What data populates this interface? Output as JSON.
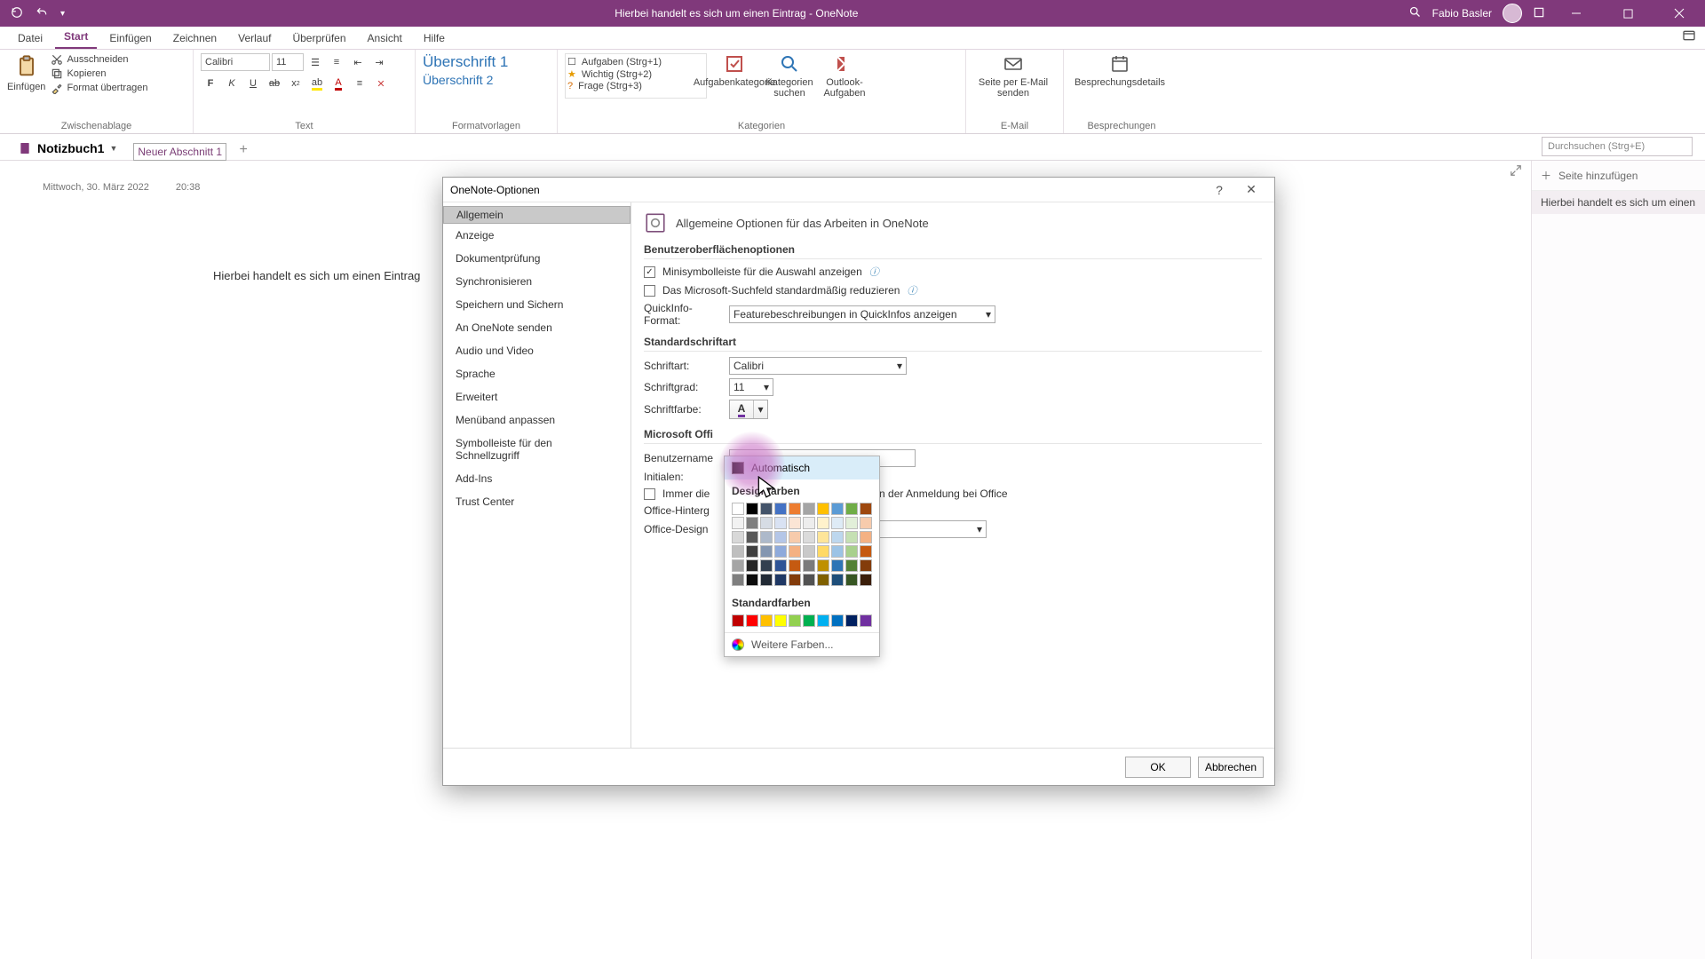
{
  "titlebar": {
    "title": "Hierbei handelt es sich um einen Eintrag  -  OneNote",
    "user": "Fabio Basler"
  },
  "menu": {
    "tabs": [
      "Datei",
      "Start",
      "Einfügen",
      "Zeichnen",
      "Verlauf",
      "Überprüfen",
      "Ansicht",
      "Hilfe"
    ],
    "active_index": 1
  },
  "ribbon": {
    "clipboard": {
      "paste": "Einfügen",
      "cut": "Ausschneiden",
      "copy": "Kopieren",
      "format": "Format übertragen",
      "group": "Zwischenablage"
    },
    "font": {
      "name": "Calibri",
      "size": "11",
      "group": "Text"
    },
    "styles": {
      "h1": "Überschrift 1",
      "h2": "Überschrift 2",
      "group": "Formatvorlagen"
    },
    "tags": {
      "items": [
        "Aufgaben (Strg+1)",
        "Wichtig (Strg+2)",
        "Frage (Strg+3)"
      ],
      "btn1": "Aufgabenkategorie",
      "btn2": "Kategorien suchen",
      "btn3": "Outlook-Aufgaben",
      "group": "Kategorien"
    },
    "email": {
      "btn": "Seite per E-Mail senden",
      "group": "E-Mail"
    },
    "meet": {
      "btn": "Besprechungsdetails",
      "group": "Besprechungen"
    }
  },
  "notebook": {
    "name": "Notizbuch1",
    "section": "Neuer Abschnitt 1",
    "search_placeholder": "Durchsuchen (Strg+E)"
  },
  "page": {
    "date": "Mittwoch, 30. März 2022",
    "time": "20:38",
    "text": "Hierbei handelt es sich um einen Eintrag"
  },
  "pagelist": {
    "add": "Seite hinzufügen",
    "item": "Hierbei handelt es sich um einen"
  },
  "dialog": {
    "title": "OneNote-Optionen",
    "nav": [
      "Allgemein",
      "Anzeige",
      "Dokumentprüfung",
      "Synchronisieren",
      "Speichern und Sichern",
      "An OneNote senden",
      "Audio und Video",
      "Sprache",
      "Erweitert",
      "Menüband anpassen",
      "Symbolleiste für den Schnellzugriff",
      "Add-Ins",
      "Trust Center"
    ],
    "nav_selected": 0,
    "heading": "Allgemeine Optionen für das Arbeiten in OneNote",
    "sec1": "Benutzeroberflächenoptionen",
    "chk_mini": "Minisymbolleiste für die Auswahl anzeigen",
    "chk_search": "Das Microsoft-Suchfeld standardmäßig reduzieren",
    "quickinfo_label": "QuickInfo-Format:",
    "quickinfo_value": "Featurebeschreibungen in QuickInfos anzeigen",
    "sec2": "Standardschriftart",
    "font_label": "Schriftart:",
    "font_value": "Calibri",
    "size_label": "Schriftgrad:",
    "size_value": "11",
    "color_label": "Schriftfarbe:",
    "sec3": "Microsoft Offi",
    "user_label": "Benutzername",
    "initials_label": "Initialen:",
    "always_label": "Immer die",
    "always_tail": "g von der Anmeldung bei Office",
    "bg_label": "Office-Hinterg",
    "theme_label": "Office-Design",
    "ok": "OK",
    "cancel": "Abbrechen"
  },
  "picker": {
    "auto": "Automatisch",
    "theme": "Designfarben",
    "theme_row": [
      "#ffffff",
      "#000000",
      "#44546a",
      "#4472c4",
      "#ed7d31",
      "#a5a5a5",
      "#ffc000",
      "#5b9bd5",
      "#70ad47",
      "#9e480e"
    ],
    "tint_rows": [
      [
        "#f2f2f2",
        "#7f7f7f",
        "#d6dce4",
        "#d9e2f3",
        "#fbe5d5",
        "#ededed",
        "#fff2cc",
        "#deebf6",
        "#e2efd9",
        "#f7cbac"
      ],
      [
        "#d8d8d8",
        "#595959",
        "#adb9ca",
        "#b4c6e7",
        "#f7cbac",
        "#dbdbdb",
        "#fee599",
        "#bdd7ee",
        "#c5e0b3",
        "#f4b183"
      ],
      [
        "#bfbfbf",
        "#3f3f3f",
        "#8496b0",
        "#8eaadb",
        "#f4b183",
        "#c9c9c9",
        "#ffd965",
        "#9cc3e5",
        "#a8d08d",
        "#c55a11"
      ],
      [
        "#a5a5a5",
        "#262626",
        "#323f4f",
        "#2f5496",
        "#c55a11",
        "#7b7b7b",
        "#bf9000",
        "#2e75b5",
        "#538135",
        "#833c0b"
      ],
      [
        "#7f7f7f",
        "#0c0c0c",
        "#222a35",
        "#1f3864",
        "#833c0b",
        "#525252",
        "#7f6000",
        "#1e4e79",
        "#375623",
        "#3b1e0a"
      ]
    ],
    "std": "Standardfarben",
    "std_row": [
      "#c00000",
      "#ff0000",
      "#ffc000",
      "#ffff00",
      "#92d050",
      "#00b050",
      "#00b0f0",
      "#0070c0",
      "#002060",
      "#7030a0"
    ],
    "more": "Weitere Farben..."
  }
}
